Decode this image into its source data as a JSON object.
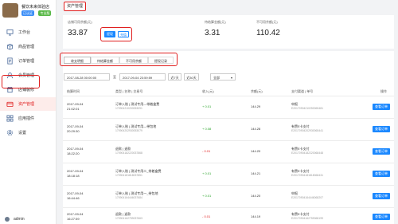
{
  "sidebar": {
    "store_name": "餐饮未来体验店",
    "badges": [
      "已认证",
      "专业版"
    ],
    "items": [
      {
        "label": "工作台",
        "icon": "desktop-icon"
      },
      {
        "label": "商品管理",
        "icon": "box-icon"
      },
      {
        "label": "订单管理",
        "icon": "order-icon"
      },
      {
        "label": "会员管理",
        "icon": "member-icon"
      },
      {
        "label": "店铺装修",
        "icon": "shop-icon"
      },
      {
        "label": "资产管理",
        "icon": "asset-icon",
        "active": true
      },
      {
        "label": "应用插件",
        "icon": "apps-icon"
      },
      {
        "label": "设置",
        "icon": "gear-icon"
      }
    ],
    "user": "admin"
  },
  "header": {
    "title": "资产管理"
  },
  "summary": {
    "withdrawable_label": "店铺可用余额(元)",
    "withdrawable_value": "33.87",
    "withdraw_btn": "提现",
    "recharge_btn": "充值",
    "pending_label": "待结算金额(元)",
    "pending_value": "3.31",
    "unavailable_label": "不可用余额(元)",
    "unavailable_value": "110.42"
  },
  "tabs": [
    "收支明细",
    "待结算金额",
    "不可用余额",
    "提现记录"
  ],
  "filters": {
    "start": "2017-08-28 00:00:00",
    "to": "至",
    "end": "2017-09-04 23:59:59",
    "btn_7": "近7天",
    "btn_30": "近30天",
    "select": "全部"
  },
  "table": {
    "headers": [
      "结算时间",
      "类型 | 名称 | 交易号",
      "收入(元)",
      "余额(元)",
      "支付渠道 | 单号",
      "操作"
    ],
    "rows": [
      {
        "date": "2017-09-04",
        "time": "21:02:01",
        "name": "订单入账 | 测试专用—带着盒费",
        "txn": "170904210200053091",
        "amount": "+ 0.01",
        "sign": "pos",
        "balance": "144.29",
        "channel": "申报",
        "channel_no": "E20170904210250065481",
        "op": "查看订单"
      },
      {
        "date": "2017-09-04",
        "time": "20:29:30",
        "name": "订单入账 | 测试专用—带包地",
        "txn": "170904202930053079",
        "amount": "+ 0.08",
        "sign": "pos",
        "balance": "144.28",
        "channel": "有赞E卡支付",
        "channel_no": "E20170904202930065441",
        "op": "查看订单"
      },
      {
        "date": "2017-09-04",
        "time": "18:22:20",
        "name": "退款 | 退款",
        "txn": "170904182220037868",
        "amount": "- 0.01",
        "sign": "neg",
        "balance": "144.20",
        "channel": "有赞E卡支付",
        "channel_no": "E20170904182220068448",
        "op": "查看订单"
      },
      {
        "date": "2017-09-04",
        "time": "18:18:18",
        "name": "订单入账 | 测试专用二_带着盒费",
        "txn": "170904181818037851",
        "amount": "+ 0.01",
        "sign": "pos",
        "balance": "144.21",
        "channel": "有赞E卡支付",
        "channel_no": "E20170904181818068431",
        "op": "查看订单"
      },
      {
        "date": "2017-09-04",
        "time": "16:44:46",
        "name": "订单入账 | 测试专用一_带包地",
        "txn": "170904164446037684",
        "amount": "+ 0.01",
        "sign": "pos",
        "balance": "144.20",
        "channel": "申报",
        "channel_no": "E20170904164446068207",
        "op": "查看订单"
      },
      {
        "date": "2017-09-04",
        "time": "16:27:59",
        "name": "退款 | 退款",
        "txn": "170904162759037663",
        "amount": "- 0.01",
        "sign": "neg",
        "balance": "144.19",
        "channel": "有赞E卡支付",
        "channel_no": "E20170904162759068199",
        "op": "查看订单"
      }
    ]
  },
  "colors": {
    "accent": "#1b88ff",
    "highlight": "#e02020",
    "positive": "#2aa52a",
    "negative": "#e02020"
  }
}
